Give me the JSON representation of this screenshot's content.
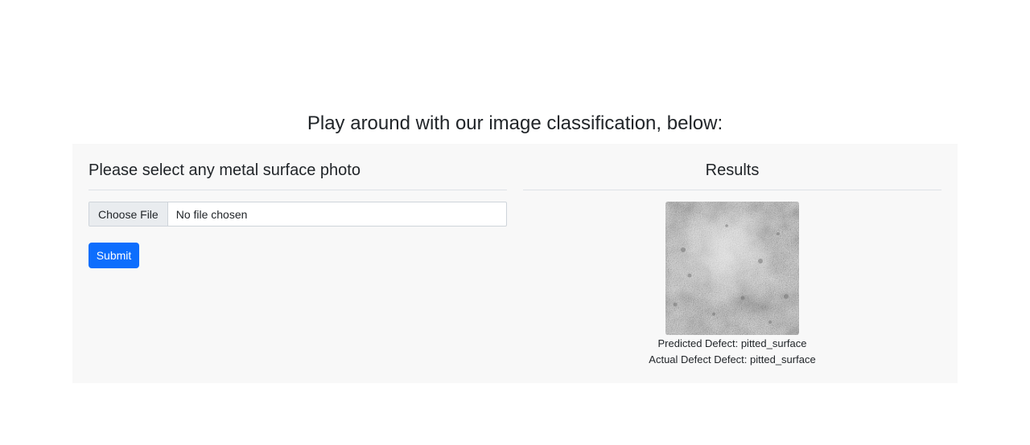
{
  "page": {
    "heading": "Play around with our image classification, below:"
  },
  "upload": {
    "title": "Please select any metal surface photo",
    "choose_file_label": "Choose File",
    "file_status": "No file chosen",
    "submit_label": "Submit"
  },
  "results": {
    "title": "Results",
    "image_description": "grayscale metal surface sample",
    "predicted_label": "Predicted Defect: pitted_surface",
    "actual_label": "Actual Defect Defect: pitted_surface"
  },
  "colors": {
    "primary": "#0d6efd",
    "panel_background": "#f8f8f8"
  }
}
